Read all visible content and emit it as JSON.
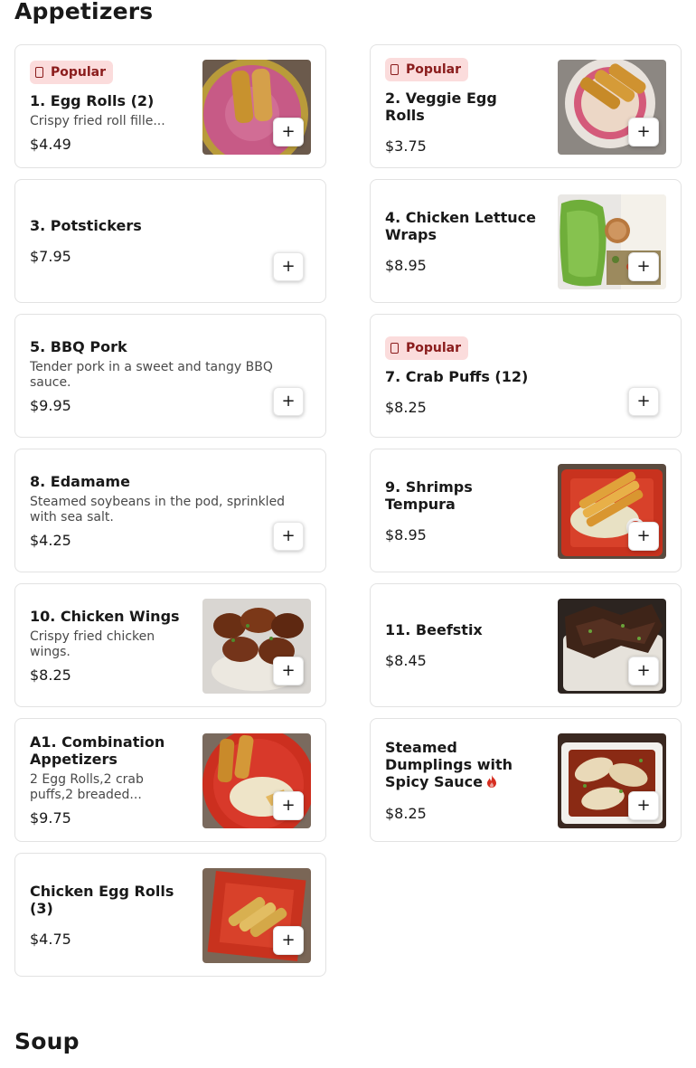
{
  "sections": {
    "appetizers_title": "Appetizers",
    "soup_title": "Soup"
  },
  "badge_label": "Popular",
  "add_label": "+",
  "items": [
    {
      "name": "1. Egg Rolls (2)",
      "desc": "Crispy fried roll fille...",
      "price": "$4.49",
      "popular": true
    },
    {
      "name": "2. Veggie Egg Rolls",
      "price": "$3.75",
      "popular": true
    },
    {
      "name": "3. Potstickers",
      "price": "$7.95"
    },
    {
      "name": "4. Chicken Lettuce Wraps",
      "price": "$8.95"
    },
    {
      "name": "5. BBQ Pork",
      "desc": "Tender pork in a sweet and tangy BBQ sauce.",
      "price": "$9.95"
    },
    {
      "name": "7. Crab Puffs (12)",
      "price": "$8.25",
      "popular": true
    },
    {
      "name": "8. Edamame",
      "desc": "Steamed soybeans in the pod, sprinkled with sea salt.",
      "price": "$4.25"
    },
    {
      "name": "9. Shrimps Tempura",
      "price": "$8.95"
    },
    {
      "name": "10. Chicken Wings",
      "desc": "Crispy fried chicken wings.",
      "price": "$8.25"
    },
    {
      "name": "11. Beefstix",
      "price": "$8.45"
    },
    {
      "name": "A1. Combination Appetizers",
      "desc": "2 Egg Rolls,2 crab puffs,2 breaded...",
      "price": "$9.75"
    },
    {
      "name": "Steamed Dumplings with Spicy Sauce",
      "price": "$8.25",
      "spicy": true
    },
    {
      "name": "Chicken Egg Rolls (3)",
      "price": "$4.75"
    }
  ],
  "colors": {
    "badge_bg": "#fbdcdc",
    "badge_text": "#8a1c1c",
    "spicy": "#d62d20"
  }
}
